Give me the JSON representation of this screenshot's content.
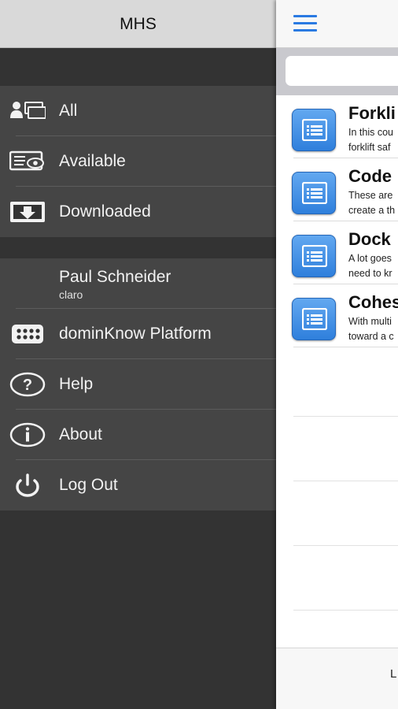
{
  "drawer": {
    "title": "MHS",
    "filters": [
      {
        "label": "All",
        "icon": "all-icon"
      },
      {
        "label": "Available",
        "icon": "available-icon"
      },
      {
        "label": "Downloaded",
        "icon": "downloaded-icon"
      }
    ],
    "user": {
      "name": "Paul Schneider",
      "org": "claro"
    },
    "menu": [
      {
        "label": "dominKnow Platform",
        "icon": "platform-icon"
      },
      {
        "label": "Help",
        "icon": "help-icon"
      },
      {
        "label": "About",
        "icon": "info-icon"
      },
      {
        "label": "Log Out",
        "icon": "power-icon"
      }
    ]
  },
  "main": {
    "menu_icon": "hamburger-icon",
    "search_placeholder": "",
    "courses": [
      {
        "title": "Forkli",
        "desc": [
          "In this cou",
          "forklift saf"
        ],
        "icon": "course-icon"
      },
      {
        "title": "Code",
        "desc": [
          "These are",
          "create a th"
        ],
        "icon": "course-icon"
      },
      {
        "title": "Dock",
        "desc": [
          "A lot goes",
          "need to kr"
        ],
        "icon": "course-icon"
      },
      {
        "title": "Cohes",
        "desc": [
          "With multi",
          "toward a c"
        ],
        "icon": "course-icon"
      }
    ],
    "footer_text": "L"
  },
  "colors": {
    "accent": "#2a7ae2",
    "drawer_bg": "#333333",
    "drawer_group": "#454545",
    "header_bg": "#d9d9d9"
  }
}
